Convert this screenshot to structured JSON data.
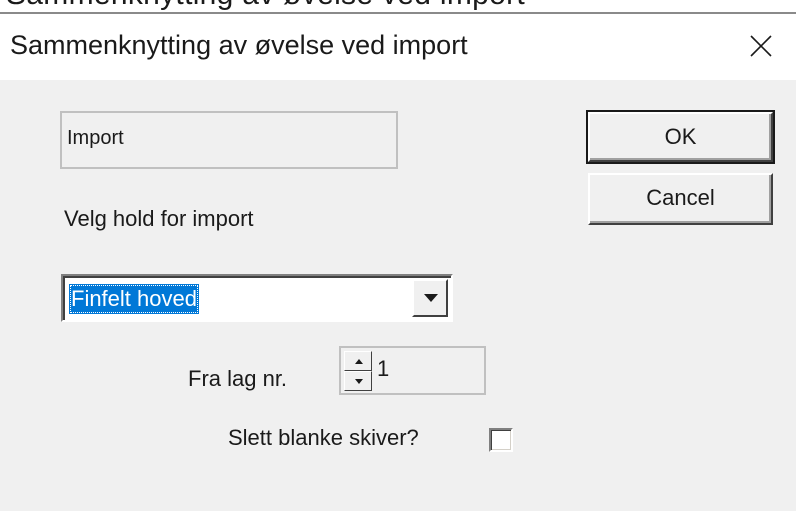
{
  "background_strip": {
    "text": "Sammenknytting av øvelse ved import"
  },
  "dialog": {
    "title": "Sammenknytting av øvelse ved import",
    "close_glyph": "×"
  },
  "group": {
    "label": "Import"
  },
  "team_select": {
    "prompt": "Velg hold for import",
    "selected": "Finfelt hoved"
  },
  "layer": {
    "label": "Fra lag nr.",
    "value": "1"
  },
  "delete_blank": {
    "label": "Slett blanke skiver?",
    "checked": false
  },
  "buttons": {
    "ok": "OK",
    "cancel": "Cancel"
  },
  "colors": {
    "selection": "#0078d7",
    "client_bg": "#f0f0f0"
  },
  "icons": {
    "close": "close-icon",
    "dropdown": "chevron-down-icon",
    "spin_up": "spin-up-icon",
    "spin_down": "spin-down-icon"
  }
}
